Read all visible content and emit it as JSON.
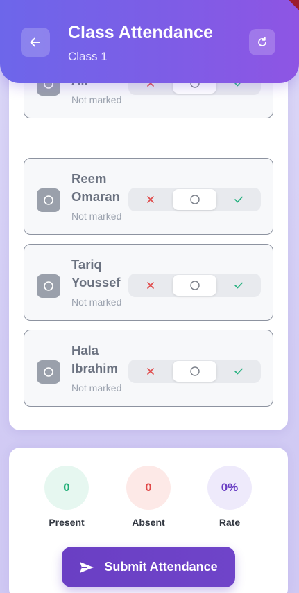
{
  "header": {
    "title": "Class Attendance",
    "subtitle": "Class 1",
    "back_icon": "arrow-left-icon",
    "refresh_icon": "refresh-icon",
    "gradient_start": "#6d66ea",
    "gradient_end": "#8e55e4"
  },
  "students": [
    {
      "name": "Ahmed Ali",
      "status": "Not marked",
      "selected": "unmarked"
    },
    {
      "name": "Reem Omaran",
      "status": "Not marked",
      "selected": "unmarked"
    },
    {
      "name": "Tariq Youssef",
      "status": "Not marked",
      "selected": "unmarked"
    },
    {
      "name": "Hala Ibrahim",
      "status": "Not marked",
      "selected": "unmarked"
    }
  ],
  "toggle_icons": {
    "absent": "x-icon",
    "unmarked": "circle-icon",
    "present": "check-icon"
  },
  "colors": {
    "absent": "#e04848",
    "present": "#22b07d",
    "rate": "#6a3fc4"
  },
  "stats": {
    "present": {
      "value": "0",
      "label": "Present",
      "bg": "#e6f7f0",
      "color": "#1fae76"
    },
    "absent": {
      "value": "0",
      "label": "Absent",
      "bg": "#fde9e7",
      "color": "#e04848"
    },
    "rate": {
      "value": "0%",
      "label": "Rate",
      "bg": "#eeeafb",
      "color": "#6a3fc4"
    }
  },
  "submit": {
    "label": "Submit Attendance",
    "icon": "send-icon"
  }
}
